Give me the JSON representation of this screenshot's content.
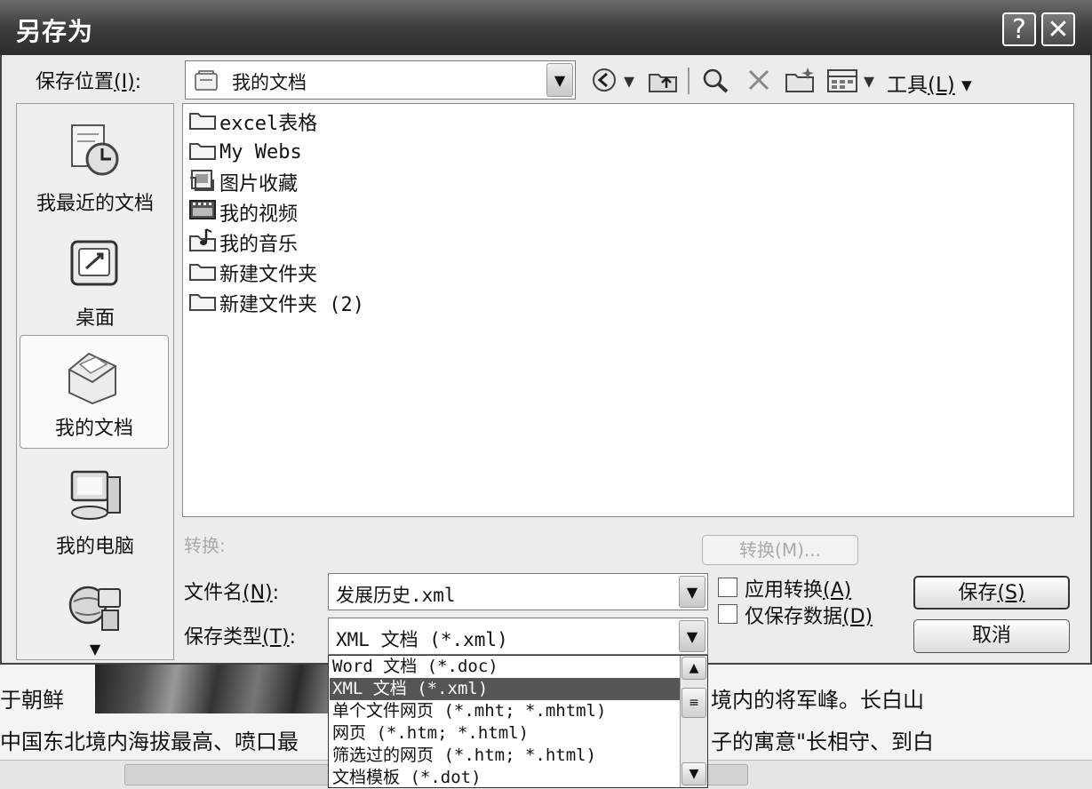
{
  "window": {
    "title": "另存为",
    "help_glyph": "?",
    "close_glyph": "✕"
  },
  "save_in": {
    "label": "保存位置",
    "accel": "(I)",
    "colon": ":",
    "value": "我的文档"
  },
  "toolbar": {
    "tools_label": "工具",
    "tools_accel": "(L)",
    "dropdown_glyph": "▾"
  },
  "places": [
    {
      "label": "我最近的文档",
      "icon": "recent-docs-icon"
    },
    {
      "label": "桌面",
      "icon": "desktop-icon"
    },
    {
      "label": "我的文档",
      "icon": "my-documents-icon"
    },
    {
      "label": "我的电脑",
      "icon": "my-computer-icon"
    },
    {
      "label": "",
      "icon": "network-places-icon"
    }
  ],
  "files": [
    {
      "name": "excel表格",
      "icon": "folder-icon"
    },
    {
      "name": "My Webs",
      "icon": "folder-icon"
    },
    {
      "name": "图片收藏",
      "icon": "picture-folder-icon"
    },
    {
      "name": "我的视频",
      "icon": "video-folder-icon"
    },
    {
      "name": "我的音乐",
      "icon": "music-folder-icon"
    },
    {
      "name": "新建文件夹",
      "icon": "folder-icon"
    },
    {
      "name": "新建文件夹 (2)",
      "icon": "folder-icon"
    }
  ],
  "transform": {
    "label": "转换:",
    "button": "转换(M)..."
  },
  "filename": {
    "label": "文件名",
    "accel": "(N)",
    "colon": ":",
    "value": "发展历史.xml"
  },
  "filetype": {
    "label": "保存类型",
    "accel": "(T)",
    "colon": ":",
    "value": "XML 文档 (*.xml)"
  },
  "options": {
    "apply_transform": "应用转换",
    "apply_accel": "(A)",
    "data_only": "仅保存数据",
    "data_accel": "(D)"
  },
  "buttons": {
    "save": "保存",
    "save_accel": "(S)",
    "cancel": "取消"
  },
  "type_options": [
    "Word 文档 (*.doc)",
    "XML 文档 (*.xml)",
    "单个文件网页 (*.mht; *.mhtml)",
    "网页 (*.htm; *.html)",
    "筛选过的网页 (*.htm; *.html)",
    "文档模板 (*.dot)"
  ],
  "selected_type_index": 1,
  "background_doc": {
    "line1_left": "于朝鲜",
    "line1_right": "境内的将军峰。长白山",
    "line2_left": "中国东北境内海拔最高、喷口最",
    "line2_right": "子的寓意\"长相守、到白"
  }
}
